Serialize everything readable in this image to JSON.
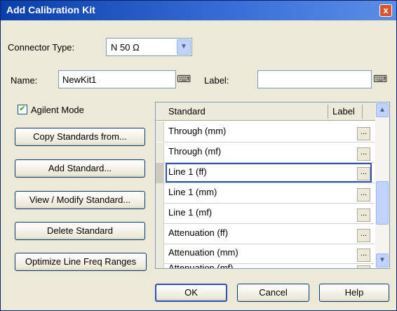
{
  "window": {
    "title": "Add Calibration Kit",
    "close_symbol": "x"
  },
  "connector": {
    "label": "Connector Type:",
    "value": "N 50 Ω"
  },
  "name": {
    "label": "Name:",
    "value": "NewKit1"
  },
  "label_field": {
    "label": "Label:",
    "value": ""
  },
  "agilent_mode": {
    "label": "Agilent Mode",
    "checked": true
  },
  "buttons": {
    "copy": "Copy Standards from...",
    "add": "Add Standard...",
    "view": "View / Modify Standard...",
    "delete": "Delete Standard",
    "optimize": "Optimize Line Freq Ranges",
    "ok": "OK",
    "cancel": "Cancel",
    "help": "Help"
  },
  "grid": {
    "headers": {
      "standard": "Standard",
      "label": "Label"
    },
    "rows": [
      {
        "standard": "Through (mm)",
        "label_button": "..."
      },
      {
        "standard": "Through (mf)",
        "label_button": "..."
      },
      {
        "standard": "Line 1 (ff)",
        "label_button": "...",
        "selected": true
      },
      {
        "standard": "Line 1 (mm)",
        "label_button": "..."
      },
      {
        "standard": "Line 1 (mf)",
        "label_button": "..."
      },
      {
        "standard": "Attenuation (ff)",
        "label_button": "..."
      },
      {
        "standard": "Attenuation (mm)",
        "label_button": "..."
      },
      {
        "standard": "Attenuation (mf)",
        "label_button": "..."
      }
    ]
  },
  "icons": {
    "keyboard": "keyboard-icon",
    "scroll_up": "▲",
    "scroll_down": "▼",
    "dropdown": "▼",
    "check": "✔"
  }
}
